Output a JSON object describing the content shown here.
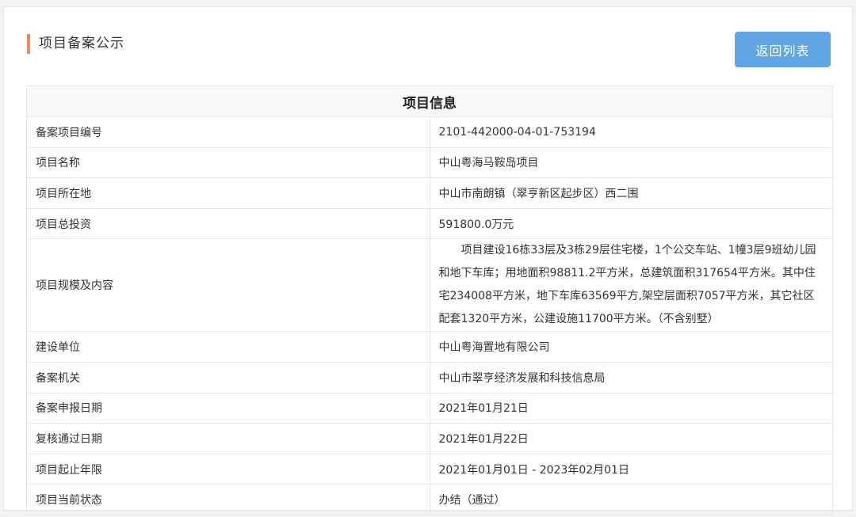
{
  "header": {
    "title": "项目备案公示",
    "back_button_label": "返回列表"
  },
  "table": {
    "title": "项目信息",
    "rows": [
      {
        "label": "备案项目编号",
        "value": "2101-442000-04-01-753194"
      },
      {
        "label": "项目名称",
        "value": "中山粤海马鞍岛项目"
      },
      {
        "label": "项目所在地",
        "value": "中山市南朗镇（翠亨新区起步区）西二围"
      },
      {
        "label": "项目总投资",
        "value": "591800.0万元"
      },
      {
        "label": "项目规模及内容",
        "value": "项目建设16栋33层及3栋29层住宅楼，1个公交车站、1幢3层9班幼儿园和地下车库；用地面积98811.2平方米，总建筑面积317654平方米。其中住宅234008平方米，地下车库63569平方,架空层面积7057平方米，其它社区配套1320平方米，公建设施11700平方米。（不含别墅）"
      },
      {
        "label": "建设单位",
        "value": "中山粤海置地有限公司"
      },
      {
        "label": "备案机关",
        "value": "中山市翠亨经济发展和科技信息局"
      },
      {
        "label": "备案申报日期",
        "value": "2021年01月21日"
      },
      {
        "label": "复核通过日期",
        "value": "2021年01月22日"
      },
      {
        "label": "项目起止年限",
        "value": "2021年01月01日 - 2023年02月01日"
      },
      {
        "label": "项目当前状态",
        "value": "办结（通过）"
      }
    ]
  }
}
